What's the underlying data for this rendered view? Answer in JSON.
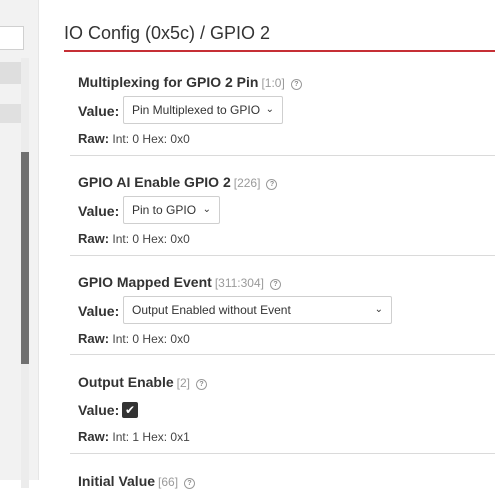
{
  "page": {
    "title": "IO Config (0x5c) / GPIO 2"
  },
  "labels": {
    "value": "Value:",
    "raw": "Raw:"
  },
  "colors": {
    "accent": "#c62f35",
    "checkbox": "#333333"
  },
  "fields": [
    {
      "name": "Multiplexing for GPIO 2 Pin",
      "range": "[1:0]",
      "value": "Pin Multiplexed to GPIO",
      "raw": "Int: 0 Hex: 0x0"
    },
    {
      "name": "GPIO AI Enable GPIO 2",
      "range": "[226]",
      "value": "Pin to GPIO",
      "raw": "Int: 0 Hex: 0x0"
    },
    {
      "name": "GPIO Mapped Event",
      "range": "[311:304]",
      "value": "Output Enabled without Event",
      "raw": "Int: 0 Hex: 0x0"
    },
    {
      "name": "Output Enable",
      "range": "[2]",
      "checked": true,
      "raw": "Int: 1 Hex: 0x1"
    },
    {
      "name": "Initial Value",
      "range": "[66]"
    }
  ]
}
